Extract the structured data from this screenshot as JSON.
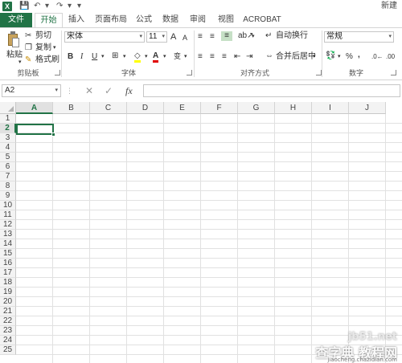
{
  "window": {
    "title": "新建",
    "app_logo": "X",
    "qat": {
      "save_icon": "💾",
      "undo_icon": "↶",
      "redo_icon": "↷",
      "customize_icon": "▾"
    }
  },
  "tabs": [
    {
      "label": "文件"
    },
    {
      "label": "开始"
    },
    {
      "label": "插入"
    },
    {
      "label": "页面布局"
    },
    {
      "label": "公式"
    },
    {
      "label": "数据"
    },
    {
      "label": "审阅"
    },
    {
      "label": "视图"
    },
    {
      "label": "ACROBAT"
    }
  ],
  "ribbon": {
    "clipboard": {
      "label": "剪贴板",
      "paste": "粘贴",
      "cut": "剪切",
      "copy": "复制",
      "format_painter": "格式刷"
    },
    "font": {
      "label": "字体",
      "font_name": "宋体",
      "font_size": "11",
      "grow_icon": "A",
      "shrink_icon": "A",
      "bold": "B",
      "italic": "I",
      "underline": "U",
      "wen": "变"
    },
    "alignment": {
      "label": "对齐方式",
      "wrap_text": "自动换行",
      "merge_center": "合并后居中"
    },
    "number": {
      "label": "数字",
      "format": "常规",
      "percent": "%",
      "comma": ","
    }
  },
  "formula_bar": {
    "name_box": "A2",
    "fx": "fx",
    "cancel": "✕",
    "enter": "✓",
    "value": ""
  },
  "sheet": {
    "columns": [
      "A",
      "B",
      "C",
      "D",
      "E",
      "F",
      "G",
      "H",
      "I",
      "J"
    ],
    "rows": [
      "1",
      "2",
      "3",
      "4",
      "5",
      "6",
      "7",
      "8",
      "9",
      "10",
      "11",
      "12",
      "13",
      "14",
      "15",
      "16",
      "17",
      "18",
      "19",
      "20",
      "21",
      "22",
      "23",
      "24",
      "25"
    ],
    "active_cell": "A2"
  },
  "watermark": {
    "top": "jb51.net",
    "main": "查字典 教程网",
    "sub": "jiaocheng.chazidian.com"
  },
  "colors": {
    "accent": "#217346"
  }
}
